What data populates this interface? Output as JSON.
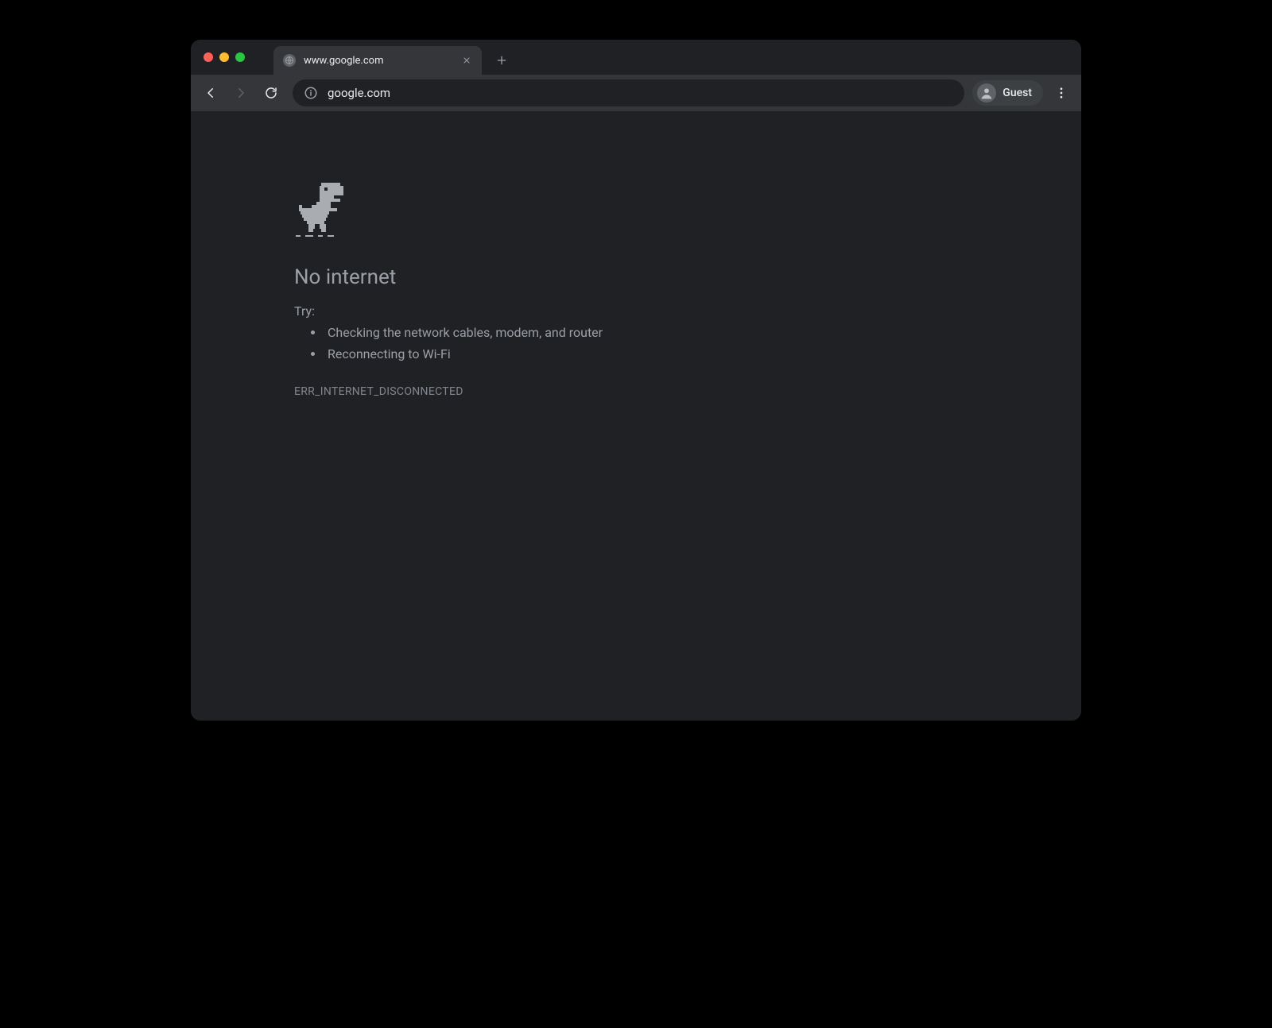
{
  "browser": {
    "tab": {
      "title": "www.google.com"
    },
    "toolbar": {
      "url": "google.com",
      "profile_label": "Guest"
    }
  },
  "error_page": {
    "title": "No internet",
    "try_label": "Try:",
    "tips": [
      "Checking the network cables, modem, and router",
      "Reconnecting to Wi-Fi"
    ],
    "error_code": "ERR_INTERNET_DISCONNECTED"
  }
}
